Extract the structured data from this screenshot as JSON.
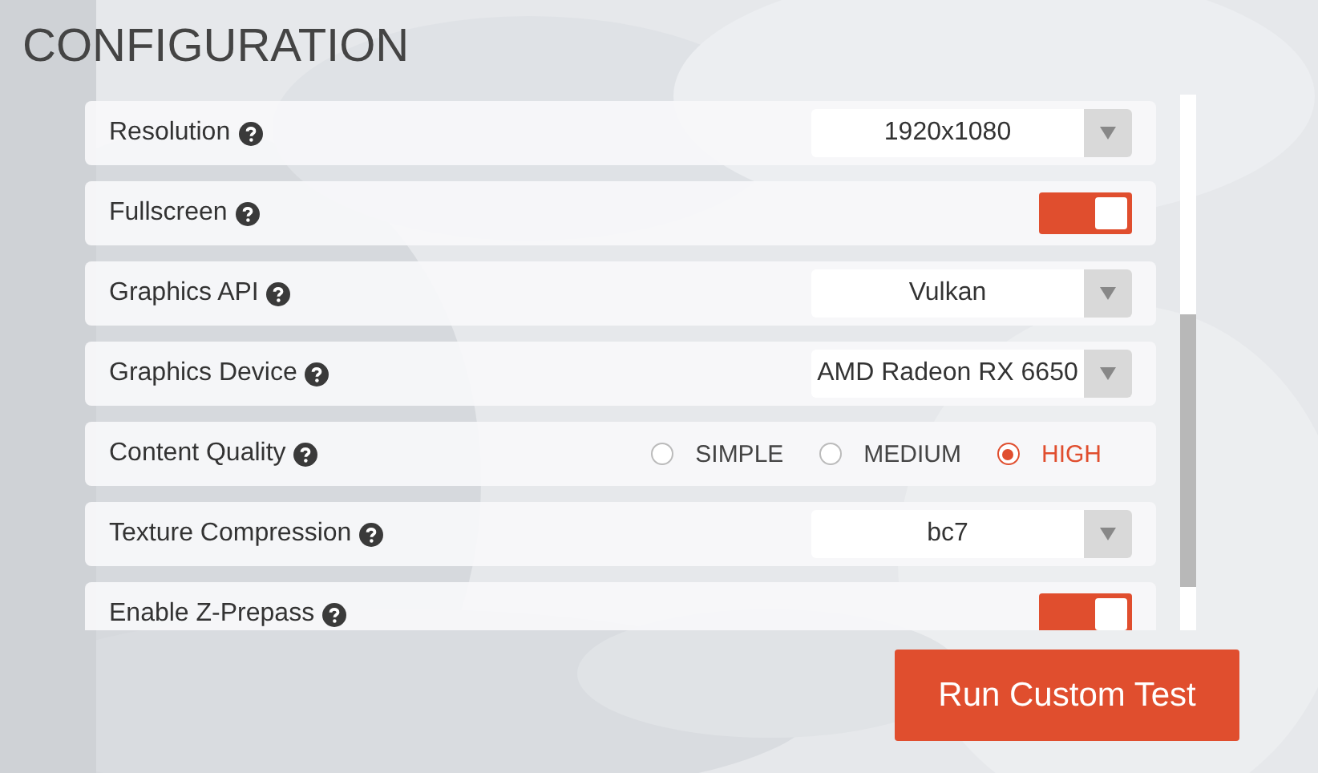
{
  "title": "CONFIGURATION",
  "settings": [
    {
      "kind": "select",
      "label": "Resolution",
      "value": "1920x1080"
    },
    {
      "kind": "toggle",
      "label": "Fullscreen",
      "on": true
    },
    {
      "kind": "select",
      "label": "Graphics API",
      "value": "Vulkan"
    },
    {
      "kind": "select",
      "label": "Graphics Device",
      "value": "AMD Radeon RX 6650"
    },
    {
      "kind": "radio",
      "label": "Content Quality",
      "options": [
        {
          "label": "SIMPLE",
          "selected": false
        },
        {
          "label": "MEDIUM",
          "selected": false
        },
        {
          "label": "HIGH",
          "selected": true
        }
      ]
    },
    {
      "kind": "select",
      "label": "Texture Compression",
      "value": "bc7"
    },
    {
      "kind": "toggle",
      "label": "Enable Z-Prepass",
      "on": true
    }
  ],
  "button": "Run Custom Test"
}
